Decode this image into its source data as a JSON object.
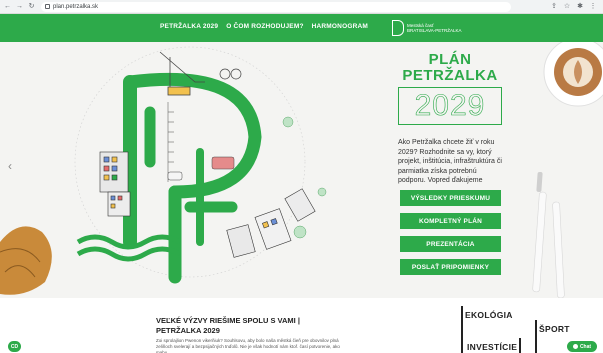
{
  "browser": {
    "url": "plan.petrzalka.sk"
  },
  "nav": {
    "items": [
      "PETRŽALKA 2029",
      "O ČOM ROZHODUJEM?",
      "HARMONOGRAM"
    ],
    "logo_line1": "Mestská časť",
    "logo_line2": "BRATISLAVA-PETRŽALKA"
  },
  "hero": {
    "title_line1": "PLÁN",
    "title_line2": "PETRŽALKA",
    "year": "2029",
    "intro": "Ako Petržalka chcete žiť v roku 2029? Rozhodnite sa vy, ktorý projekt, inštitúcia, infraštruktúra či parmiatka získa potrebnú podporu. Vopred ďakujeme",
    "buttons": [
      "VÝSLEDKY PRIESKUMU",
      "KOMPLETNÝ PLÁN",
      "PREZENTÁCIA",
      "POSLAŤ PRIPOMIENKY"
    ]
  },
  "bottom": {
    "title_line1": "VEĽKÉ VÝZVY RIEŠIME SPOLU S VAMI |",
    "title_line2": "PETRŽALKA 2029",
    "text": "Zoi sprolajlion Pwenon vikerňiuk? Souhlsovu, aby bolo naša městká čieň pre obovnilov plná zeliňoch svelerají a bezpsijačných tnďolů. Nie je však hodnotí nám ktoř. časí potvorenie, ako mahu",
    "categories": [
      "EKOLÓGIA",
      "ŠPORT",
      "INVESTÍCIE"
    ]
  },
  "badges": {
    "cd": "CD",
    "chat": "Chat"
  },
  "colors": {
    "accent": "#2daa4a"
  }
}
